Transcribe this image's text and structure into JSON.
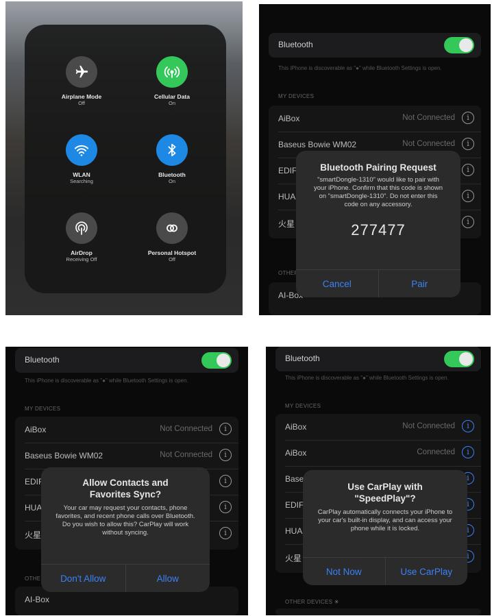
{
  "panel1": {
    "tiles": [
      {
        "label": "Airplane Mode",
        "sub": "Off",
        "icon": "airplane-icon",
        "color": "#4a4a4a"
      },
      {
        "label": "Cellular Data",
        "sub": "On",
        "icon": "cellular-antenna-icon",
        "color": "#34c759"
      },
      {
        "label": "WLAN",
        "sub": "Searching",
        "icon": "wifi-icon",
        "color": "#1e88e5"
      },
      {
        "label": "Bluetooth",
        "sub": "On",
        "icon": "bluetooth-icon",
        "color": "#1e88e5"
      },
      {
        "label": "AirDrop",
        "sub": "Receiving Off",
        "icon": "airdrop-icon",
        "color": "#4a4a4a"
      },
      {
        "label": "Personal Hotspot",
        "sub": "Off",
        "icon": "hotspot-link-icon",
        "color": "#4a4a4a"
      }
    ]
  },
  "panel2": {
    "bluetooth_label": "Bluetooth",
    "discoverable_text": "This iPhone is discoverable as \"●\" while Bluetooth Settings is open.",
    "my_devices": "MY DEVICES",
    "other_devices": "OTHER",
    "devices": [
      {
        "name": "AiBox",
        "status": "Not Connected"
      },
      {
        "name": "Baseus Bowie WM02",
        "status": "Not Connected"
      },
      {
        "name": "EDIF",
        "status": ""
      },
      {
        "name": "HUA",
        "status": ""
      },
      {
        "name": "火星",
        "status": ""
      }
    ],
    "other_device": "AI-Box",
    "alert": {
      "title": "Bluetooth Pairing Request",
      "message": "\"smartDongle-1310\" would like to pair with your iPhone. Confirm that this code is shown on \"smartDongle-1310\". Do not enter this code on any accessory.",
      "code": "277477",
      "cancel": "Cancel",
      "confirm": "Pair"
    }
  },
  "panel3": {
    "bluetooth_label": "Bluetooth",
    "discoverable_text": "This iPhone is discoverable as \"●\" while Bluetooth Settings is open.",
    "my_devices": "MY DEVICES",
    "other_devices": "OTHE",
    "devices": [
      {
        "name": "AiBox",
        "status": "Not Connected"
      },
      {
        "name": "Baseus Bowie WM02",
        "status": "Not Connected"
      },
      {
        "name": "EDIF",
        "status": ""
      },
      {
        "name": "HUA",
        "status": ""
      },
      {
        "name": "火星",
        "status": ""
      }
    ],
    "other_device": "AI-Box",
    "alert": {
      "title": "Allow Contacts and Favorites Sync?",
      "message": "Your car may request your contacts, phone favorites, and recent phone calls over Bluetooth. Do you wish to allow this? CarPlay will work without syncing.",
      "cancel": "Don't Allow",
      "confirm": "Allow"
    }
  },
  "panel4": {
    "bluetooth_label": "Bluetooth",
    "discoverable_text": "This iPhone is discoverable as \"●\" while Bluetooth Settings is open.",
    "my_devices": "MY DEVICES",
    "other_devices": "OTHER DEVICES",
    "devices": [
      {
        "name": "AiBox",
        "status": "Not Connected"
      },
      {
        "name": "AiBox",
        "status": "Connected"
      },
      {
        "name": "Base",
        "status": ""
      },
      {
        "name": "EDIF",
        "status": ""
      },
      {
        "name": "HUA",
        "status": ""
      },
      {
        "name": "火星",
        "status": ""
      }
    ],
    "alert": {
      "title": "Use CarPlay with \"SpeedPlay\"?",
      "message": "CarPlay automatically connects your iPhone to your car's built-in display, and can access your phone while it is locked.",
      "cancel": "Not Now",
      "confirm": "Use CarPlay"
    }
  },
  "colors": {
    "accent": "#3b82f6",
    "toggle_on": "#34c759"
  }
}
